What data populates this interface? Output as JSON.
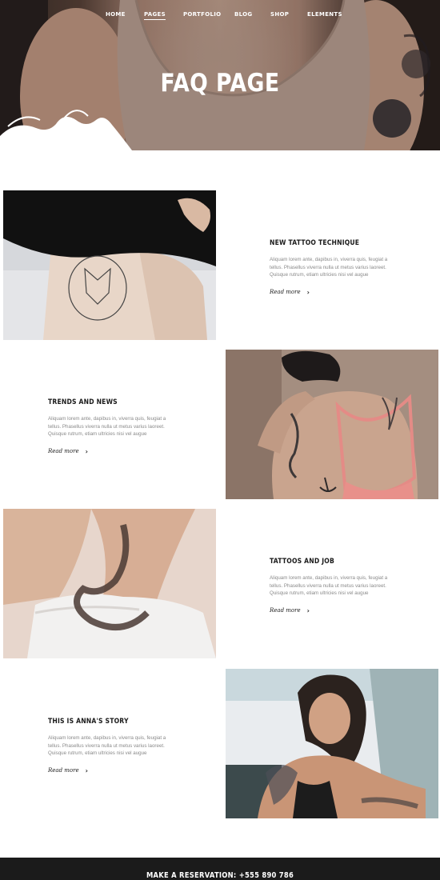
{
  "nav": [
    {
      "label": "Home"
    },
    {
      "label": "Pages"
    },
    {
      "label": "Portfolio"
    },
    {
      "label": "Blog"
    },
    {
      "label": "Shop"
    },
    {
      "label": "Elements"
    }
  ],
  "hero": {
    "title": "FAQ PAGE"
  },
  "posts": [
    {
      "title": "NEW TATTOO TECHNIQUE",
      "excerpt": [
        "Aliquam lorem ante, dapibus in, viverra quis, feugiat a",
        "tellus. Phasellus viverra nulla ut metus varius laoreet.",
        "Quisque rutrum, etiam ultricies nisi vel augue"
      ],
      "read_more": "Read more"
    },
    {
      "title": "TRENDS AND NEWS",
      "excerpt": [
        "Aliquam lorem ante, dapibus in, viverra quis, feugiat a",
        "tellus. Phasellus viverra nulla ut metus varius laoreet.",
        "Quisque rutrum, etiam ultricies nisi vel augue"
      ],
      "read_more": "Read more"
    },
    {
      "title": "TATTOOS AND JOB",
      "excerpt": [
        "Aliquam lorem ante, dapibus in, viverra quis, feugiat a",
        "tellus. Phasellus viverra nulla ut metus varius laoreet.",
        "Quisque rutrum, etiam ultricies nisi vel augue"
      ],
      "read_more": "Read more"
    },
    {
      "title": "THIS IS ANNA'S STORY",
      "excerpt": [
        "Aliquam lorem ante, dapibus in, viverra quis, feugiat a",
        "tellus. Phasellus viverra nulla ut metus varius laoreet.",
        "Quisque rutrum, etiam ultricies nisi vel augue"
      ],
      "read_more": "Read more"
    }
  ],
  "footer": {
    "text": "MAKE A RESERVATION: +555 890 786"
  },
  "icons": {
    "read_more": "chevron-right-icon"
  },
  "colors": {
    "footer_bg": "#1b1b1b",
    "text_dark": "#1a1a1a",
    "text_muted": "#8a8a8a"
  }
}
